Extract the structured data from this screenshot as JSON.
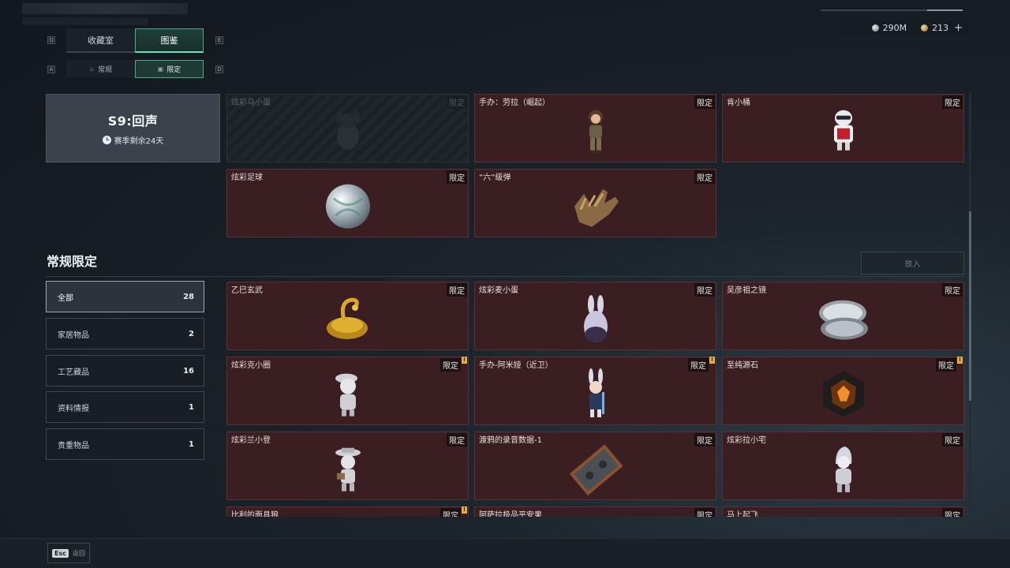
{
  "currency": {
    "silver": "290M",
    "gold": "213",
    "plus": "+"
  },
  "keyhints": {
    "q": "Q",
    "e": "E",
    "a": "A",
    "d": "D"
  },
  "tabs": [
    {
      "label": "收藏室"
    },
    {
      "label": "图鉴"
    }
  ],
  "subtabs": [
    {
      "label": "常规"
    },
    {
      "label": "限定"
    }
  ],
  "season": {
    "title": "S9:回声",
    "remaining": "赛季剩余24天"
  },
  "tag_label": "限定",
  "season_items": [
    {
      "name": "炫彩乌小蛋",
      "locked": true
    },
    {
      "name": "手办：劳拉（崛起）"
    },
    {
      "name": "肯小桶"
    },
    {
      "name": "炫彩足球"
    },
    {
      "name": "“六”级弹"
    }
  ],
  "section": {
    "title": "常规限定",
    "put_in": "放入"
  },
  "categories": [
    {
      "label": "全部",
      "count": "28"
    },
    {
      "label": "家居物品",
      "count": "2"
    },
    {
      "label": "工艺藏品",
      "count": "16"
    },
    {
      "label": "资料情报",
      "count": "1"
    },
    {
      "label": "贵重物品",
      "count": "1"
    }
  ],
  "items": [
    {
      "name": "乙巳玄武"
    },
    {
      "name": "炫彩麦小蛋"
    },
    {
      "name": "吴彦祖之镜"
    },
    {
      "name": "炫彩克小圈",
      "alert": "!"
    },
    {
      "name": "手办-阿米娅（近卫）",
      "alert": "!"
    },
    {
      "name": "至纯源石",
      "alert": "!"
    },
    {
      "name": "炫彩兰小登"
    },
    {
      "name": "渡鸦的录音数据-1"
    },
    {
      "name": "炫彩拉小宅"
    },
    {
      "name": "比利的面具狼",
      "alert": "!"
    },
    {
      "name": "阿萨拉极品平安果"
    },
    {
      "name": "马上起飞"
    }
  ],
  "footer": {
    "esc_key": "Esc",
    "esc_label": "返回"
  },
  "colors": {
    "accent": "#4fa88c",
    "card_bg": "#3a1e21",
    "alert": "#e3b23c"
  }
}
